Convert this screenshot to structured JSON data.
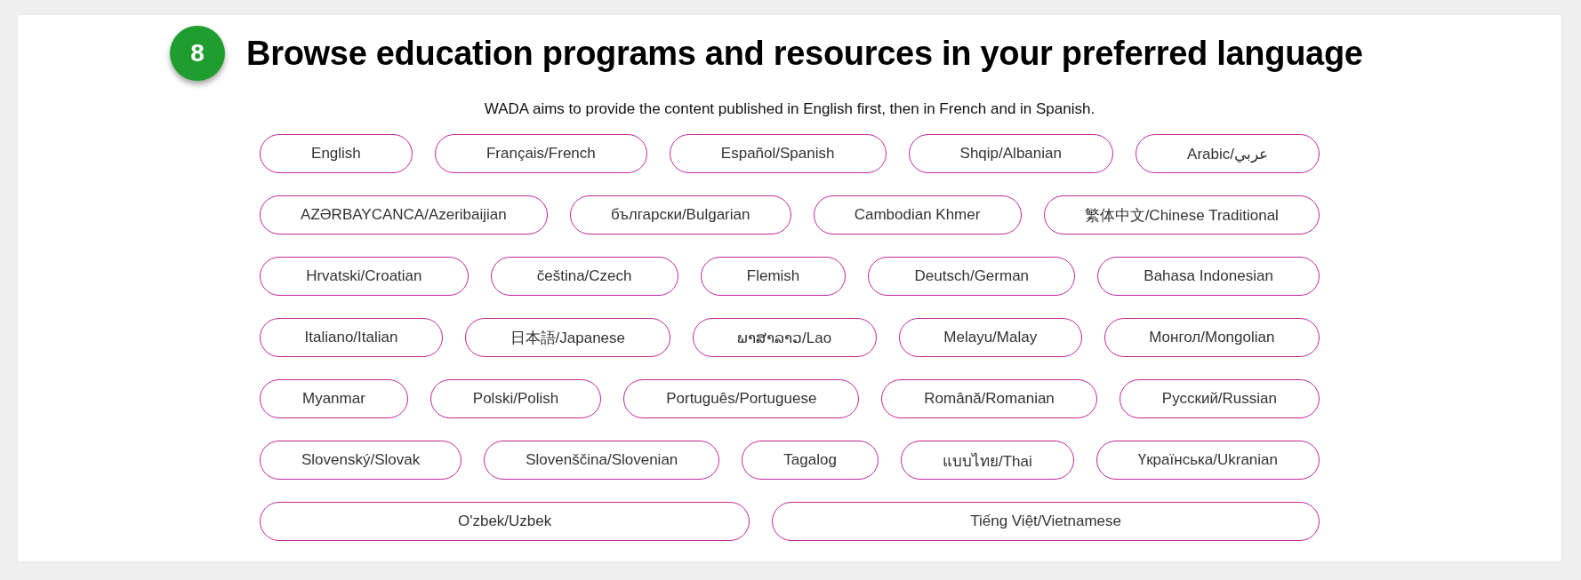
{
  "step": {
    "number": "8",
    "title": "Browse education programs and resources in your preferred language"
  },
  "intro": "WADA aims to provide the content published in English first, then in French and in Spanish.",
  "language_rows": [
    [
      "English",
      "Français/French",
      "Español/Spanish",
      "Shqip/Albanian",
      "Arabic/عربي"
    ],
    [
      "AZƏRBAYCANCA/Azeribaijian",
      "български/Bulgarian",
      "Cambodian Khmer",
      "繁体中文/Chinese Traditional"
    ],
    [
      "Hrvatski/Croatian",
      "čeština/Czech",
      "Flemish",
      "Deutsch/German",
      "Bahasa Indonesian"
    ],
    [
      "Italiano/Italian",
      "日本語/Japanese",
      "ພາສາລາວ/Lao",
      "Melayu/Malay",
      "Монгол/Mongolian"
    ],
    [
      "Myanmar",
      "Polski/Polish",
      "Português/Portuguese",
      "Română/Romanian",
      "Русский/Russian"
    ],
    [
      "Slovenský/Slovak",
      "Slovenščina/Slovenian",
      "Tagalog",
      "แบบไทย/Thai",
      "Үкраїнська/Ukranian"
    ],
    [
      "O'zbek/Uzbek",
      "Tiếng Việt/Vietnamese"
    ]
  ]
}
